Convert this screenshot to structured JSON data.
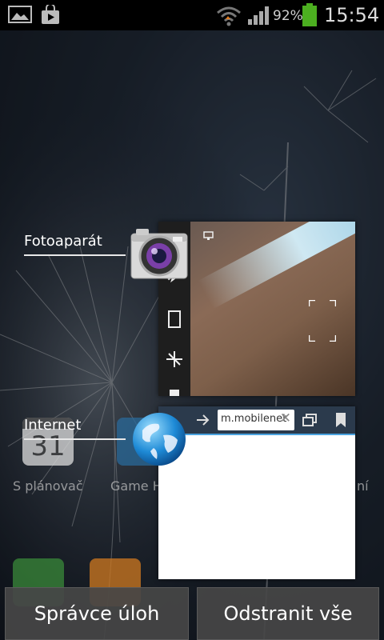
{
  "status_bar": {
    "battery_percent": "92%",
    "time": "15:54",
    "icons": [
      "gallery-notification-icon",
      "play-store-notification-icon",
      "wifi-icon",
      "signal-icon",
      "battery-icon"
    ],
    "battery_color": "#4caf20"
  },
  "home_screen": {
    "calendar_day": "31",
    "labels": [
      "S plánovač",
      "Game H",
      "ní"
    ]
  },
  "recent_apps": [
    {
      "name": "Fotoaparát",
      "icon": "camera-app-icon"
    },
    {
      "name": "Internet",
      "icon": "internet-globe-icon",
      "url_chip": "m.mobilenet"
    }
  ],
  "buttons": {
    "task_manager": "Správce úloh",
    "remove_all": "Odstranit vše"
  }
}
